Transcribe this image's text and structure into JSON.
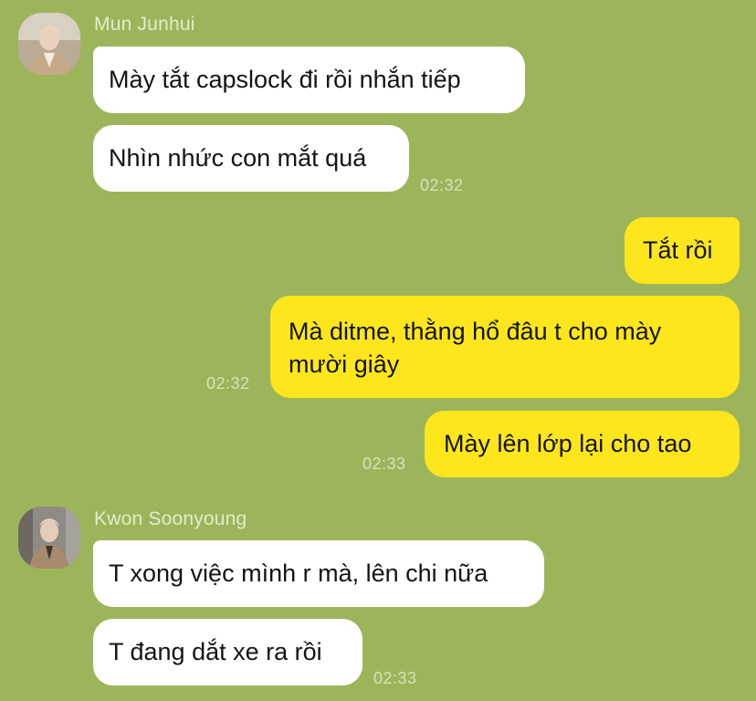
{
  "conversation": [
    {
      "sender": "Mun Junhui",
      "avatar": "avatar-photo",
      "messages": [
        {
          "text": "Mày tắt capslock đi rồi nhắn tiếp"
        },
        {
          "text": "Nhìn nhức con mắt quá",
          "time": "02:32"
        }
      ]
    },
    {
      "sender": "me",
      "messages": [
        {
          "text": "Tắt rồi"
        },
        {
          "text": "Mà ditme, thằng hổ đâu t cho mày mười giây",
          "line1": "Mà ditme, thằng hổ đâu t cho mày",
          "line2": "mười giây",
          "time": "02:32"
        },
        {
          "text": "Mày lên lớp lại cho tao",
          "time": "02:33"
        }
      ]
    },
    {
      "sender": "Kwon Soonyoung",
      "avatar": "avatar-photo",
      "messages": [
        {
          "text": "T xong việc mình r mà, lên chi nữa"
        },
        {
          "text": "T đang dắt xe ra rồi",
          "time": "02:33"
        }
      ]
    }
  ],
  "colors": {
    "background": "#9db55a",
    "incoming_bubble": "#ffffff",
    "outgoing_bubble": "#fde61c",
    "timestamp": "#d7e1be",
    "sender_name": "#e3ebcd"
  }
}
